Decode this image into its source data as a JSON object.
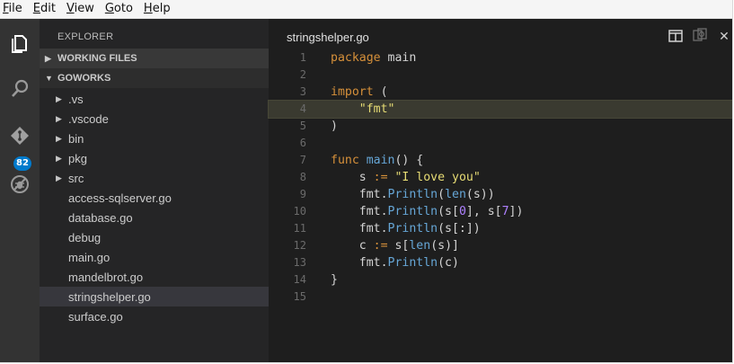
{
  "menubar": {
    "items": [
      {
        "accel": "F",
        "rest": "ile"
      },
      {
        "accel": "E",
        "rest": "dit"
      },
      {
        "accel": "V",
        "rest": "iew"
      },
      {
        "accel": "G",
        "rest": "oto"
      },
      {
        "accel": "H",
        "rest": "elp"
      }
    ]
  },
  "activitybar": {
    "icons": [
      "files-icon",
      "search-icon",
      "git-icon",
      "debug-icon"
    ],
    "git_badge": "82",
    "accent": "#007acc"
  },
  "sidebar": {
    "title": "EXPLORER",
    "working_files": "WORKING FILES",
    "folder": "GOWORKS",
    "dirs": [
      ".vs",
      ".vscode",
      "bin",
      "pkg",
      "src"
    ],
    "files": [
      "access-sqlserver.go",
      "database.go",
      "debug",
      "main.go",
      "mandelbrot.go",
      "stringshelper.go",
      "surface.go"
    ],
    "selected": "stringshelper.go"
  },
  "editor": {
    "title": "stringshelper.go",
    "line_numbers": [
      "1",
      "2",
      "3",
      "4",
      "5",
      "6",
      "7",
      "8",
      "9",
      "10",
      "11",
      "12",
      "13",
      "14",
      "15"
    ],
    "current_line": 4,
    "colors": {
      "keyword": "#d6903a",
      "string": "#e6db74",
      "function": "#66a6d6",
      "number": "#ae81ff"
    },
    "lines": [
      [
        {
          "t": "package",
          "c": "k"
        },
        {
          "t": " main",
          "c": ""
        }
      ],
      [],
      [
        {
          "t": "import",
          "c": "k"
        },
        {
          "t": " (",
          "c": ""
        }
      ],
      [
        {
          "t": "    ",
          "c": ""
        },
        {
          "t": "\"fmt\"",
          "c": "s"
        }
      ],
      [
        {
          "t": ")",
          "c": ""
        }
      ],
      [],
      [
        {
          "t": "func",
          "c": "k"
        },
        {
          "t": " ",
          "c": ""
        },
        {
          "t": "main",
          "c": "n"
        },
        {
          "t": "() {",
          "c": ""
        }
      ],
      [
        {
          "t": "    s ",
          "c": ""
        },
        {
          "t": ":=",
          "c": "k"
        },
        {
          "t": " ",
          "c": ""
        },
        {
          "t": "\"I love you\"",
          "c": "s"
        }
      ],
      [
        {
          "t": "    fmt.",
          "c": ""
        },
        {
          "t": "Println",
          "c": "n"
        },
        {
          "t": "(",
          "c": ""
        },
        {
          "t": "len",
          "c": "n"
        },
        {
          "t": "(s))",
          "c": ""
        }
      ],
      [
        {
          "t": "    fmt.",
          "c": ""
        },
        {
          "t": "Println",
          "c": "n"
        },
        {
          "t": "(s[",
          "c": ""
        },
        {
          "t": "0",
          "c": "b"
        },
        {
          "t": "], s[",
          "c": ""
        },
        {
          "t": "7",
          "c": "b"
        },
        {
          "t": "])",
          "c": ""
        }
      ],
      [
        {
          "t": "    fmt.",
          "c": ""
        },
        {
          "t": "Println",
          "c": "n"
        },
        {
          "t": "(s[:])",
          "c": ""
        }
      ],
      [
        {
          "t": "    c ",
          "c": ""
        },
        {
          "t": ":=",
          "c": "k"
        },
        {
          "t": " s[",
          "c": ""
        },
        {
          "t": "len",
          "c": "n"
        },
        {
          "t": "(s)]",
          "c": ""
        }
      ],
      [
        {
          "t": "    fmt.",
          "c": ""
        },
        {
          "t": "Println",
          "c": "n"
        },
        {
          "t": "(c)",
          "c": ""
        }
      ],
      [
        {
          "t": "}",
          "c": ""
        }
      ],
      []
    ]
  }
}
